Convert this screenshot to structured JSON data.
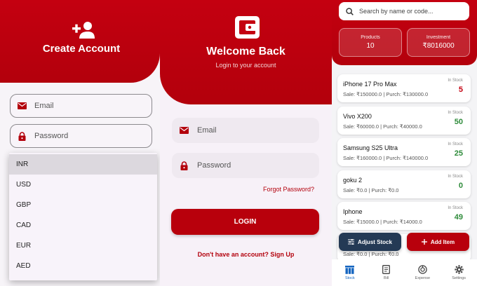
{
  "signup": {
    "title": "Create Account",
    "email_placeholder": "Email",
    "password_placeholder": "Password",
    "currency_options": [
      "INR",
      "USD",
      "GBP",
      "CAD",
      "EUR",
      "AED"
    ],
    "selected_currency": "INR"
  },
  "login": {
    "title": "Welcome Back",
    "subtitle": "Login to your account",
    "email_placeholder": "Email",
    "password_placeholder": "Password",
    "forgot_label": "Forgot Password?",
    "login_label": "LOGIN",
    "signup_link": "Don't have an account? Sign Up"
  },
  "stock": {
    "search_placeholder": "Search by name or code...",
    "stats": [
      {
        "label": "Products",
        "value": "10"
      },
      {
        "label": "Investment",
        "value": "₹8016000"
      }
    ],
    "items": [
      {
        "name": "iPhone 17 Pro Max",
        "prices": "Sale: ₹150000.0 | Purch: ₹130000.0",
        "status": "In Stock",
        "qty": "5"
      },
      {
        "name": "Vivo X200",
        "prices": "Sale: ₹60000.0 | Purch: ₹40000.0",
        "status": "In Stock",
        "qty": "50"
      },
      {
        "name": "Samsung S25 Ultra",
        "prices": "Sale: ₹160000.0 | Purch: ₹140000.0",
        "status": "In Stock",
        "qty": "25"
      },
      {
        "name": "goku 2",
        "prices": "Sale: ₹0.0 | Purch: ₹0.0",
        "status": "In Stock",
        "qty": "0"
      },
      {
        "name": "Iphone",
        "prices": "Sale: ₹15000.0 | Purch: ₹14000.0",
        "status": "In Stock",
        "qty": "49"
      },
      {
        "name": "",
        "prices": "Sale: ₹0.0 | Purch: ₹0.0",
        "status": "",
        "qty": ""
      }
    ],
    "adjust_label": "Adjust Stock",
    "add_label": "Add Item",
    "nav": [
      {
        "label": "Stock",
        "icon": "stock-icon"
      },
      {
        "label": "Bill",
        "icon": "bill-icon"
      },
      {
        "label": "Expense",
        "icon": "expense-icon"
      },
      {
        "label": "Settings",
        "icon": "settings-icon"
      }
    ]
  },
  "colors": {
    "brand_red": "#b8000c",
    "qty_green": "#2e8b3a",
    "adjust_navy": "#243a55",
    "nav_active_blue": "#1565c0"
  }
}
